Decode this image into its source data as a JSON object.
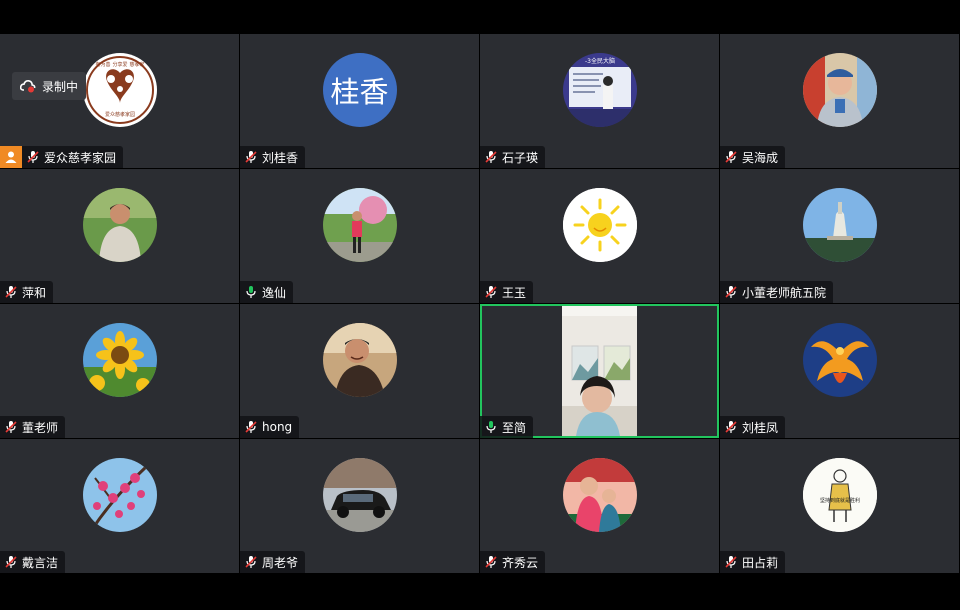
{
  "recording": {
    "label": "录制中",
    "icon": "cloud-record-icon"
  },
  "participants": [
    {
      "name": "爱众慈孝家园",
      "mic": "muted",
      "host": true,
      "avatar": "logo",
      "logo_text": [
        "有为善",
        "分享爱",
        "慈孝家"
      ],
      "logo_footer": "爱众慈孝家园"
    },
    {
      "name": "刘桂香",
      "mic": "muted",
      "avatar": "text",
      "avatar_text": "桂香"
    },
    {
      "name": "石子瑛",
      "mic": "muted",
      "avatar": "photo",
      "photo_caption": "-3全民大脑"
    },
    {
      "name": "吴海成",
      "mic": "muted",
      "avatar": "photo"
    },
    {
      "name": "萍和",
      "mic": "muted",
      "avatar": "photo"
    },
    {
      "name": "逸仙",
      "mic": "active",
      "avatar": "photo"
    },
    {
      "name": "王玉",
      "mic": "muted",
      "avatar": "photo"
    },
    {
      "name": "小董老师航五院",
      "mic": "muted",
      "avatar": "photo"
    },
    {
      "name": "董老师",
      "mic": "muted",
      "avatar": "photo"
    },
    {
      "name": "hong",
      "mic": "muted",
      "avatar": "photo"
    },
    {
      "name": "至简",
      "mic": "active",
      "avatar": "video",
      "speaking": true
    },
    {
      "name": "刘桂凤",
      "mic": "muted",
      "avatar": "photo"
    },
    {
      "name": "戴言洁",
      "mic": "muted",
      "avatar": "photo"
    },
    {
      "name": "周老爷",
      "mic": "muted",
      "avatar": "photo"
    },
    {
      "name": "齐秀云",
      "mic": "muted",
      "avatar": "photo"
    },
    {
      "name": "田占莉",
      "mic": "muted",
      "avatar": "photo",
      "drawing_text": "坚持到底就是胜利"
    }
  ],
  "colors": {
    "speaking_border": "#22c55e",
    "host_badge": "#f08a24",
    "mic_active": "#22c55e",
    "tile_bg": "#2b2d32"
  }
}
